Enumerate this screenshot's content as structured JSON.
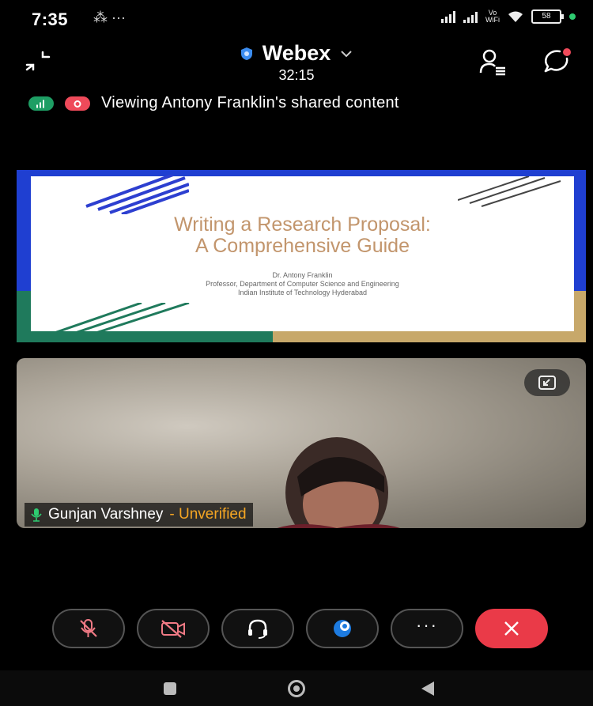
{
  "status": {
    "time": "7:35",
    "extra": "⁂ ···",
    "wifi_label": "Vo\nWiFi",
    "battery": "58"
  },
  "header": {
    "app_title": "Webex",
    "timer": "32:15"
  },
  "banner": {
    "text": "Viewing Antony Franklin's shared content"
  },
  "slide": {
    "title_line1": "Writing a Research Proposal:",
    "title_line2": "A Comprehensive Guide",
    "author": "Dr. Antony Franklin",
    "role": "Professor, Department of Computer Science and Engineering",
    "institute": "Indian Institute of Technology Hyderabad"
  },
  "video": {
    "participant_name": "Gunjan Varshney",
    "separator": " - ",
    "verification": "Unverified"
  },
  "controls": {
    "more_label": "···"
  },
  "colors": {
    "end_call": "#ea3a48",
    "unverified": "#f5a623",
    "slide_title": "#c2956c"
  }
}
